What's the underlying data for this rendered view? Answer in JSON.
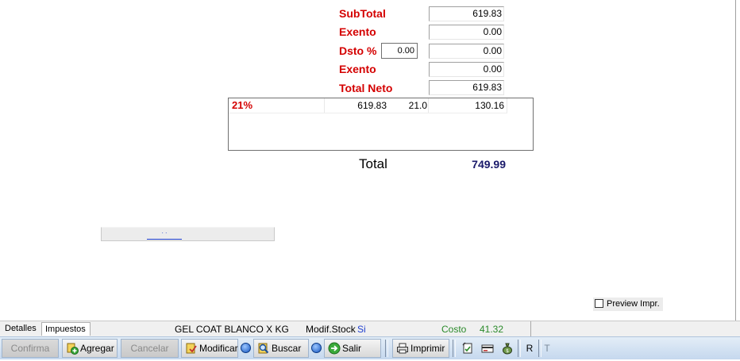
{
  "totals": {
    "subtotal_label": "SubTotal",
    "subtotal_value": "619.83",
    "exento1_label": "Exento",
    "exento1_value": "0.00",
    "dsto_label": "Dsto %",
    "dsto_percent": "0.00",
    "dsto_value": "0.00",
    "exento2_label": "Exento",
    "exento2_value": "0.00",
    "totalneto_label": "Total Neto",
    "totalneto_value": "619.83"
  },
  "taxes": [
    {
      "name": "21%",
      "base": "619.83",
      "rate": "21.0",
      "amount": "130.16"
    }
  ],
  "total": {
    "label": "Total",
    "value": "749.99"
  },
  "link_text": ". .",
  "preview": {
    "label": "Preview Impr.",
    "checked": false
  },
  "statusbar": {
    "tabs": [
      "Detalles",
      "Impuestos"
    ],
    "active_tab": "Impuestos",
    "product": "GEL COAT BLANCO X KG",
    "modif_label": "Modif.Stock",
    "modif_value": "Si",
    "costo_label": "Costo",
    "costo_value": "41.32"
  },
  "toolbar": {
    "confirma": "Confirma",
    "agregar": "Agregar",
    "cancelar": "Cancelar",
    "modificar": "Modificar",
    "buscar": "Buscar",
    "salir": "Salir",
    "imprimir": "Imprimir",
    "r": "R",
    "t": "T"
  },
  "colors": {
    "label_red": "#d40000",
    "total_blue": "#1a1a6a",
    "costo_green": "#2a8a2a",
    "modif_blue": "#1f3fd0"
  }
}
